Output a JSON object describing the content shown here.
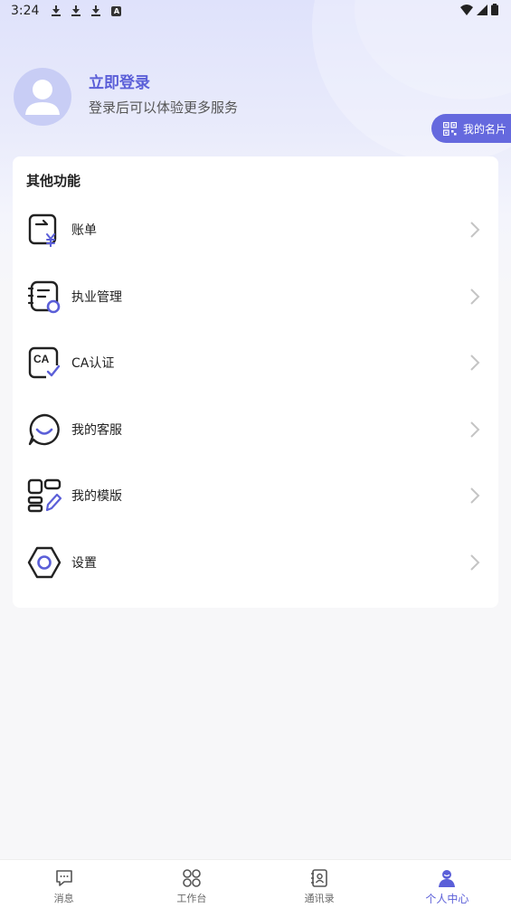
{
  "status_bar": {
    "time": "3:24"
  },
  "profile": {
    "login_title": "立即登录",
    "login_subtitle": "登录后可以体验更多服务",
    "card_button": "我的名片"
  },
  "section": {
    "title": "其他功能",
    "items": [
      {
        "label": "账单",
        "icon": "bill-icon"
      },
      {
        "label": "执业管理",
        "icon": "practice-management-icon"
      },
      {
        "label": "CA认证",
        "icon": "ca-certificate-icon"
      },
      {
        "label": "我的客服",
        "icon": "customer-service-icon"
      },
      {
        "label": "我的模版",
        "icon": "template-icon"
      },
      {
        "label": "设置",
        "icon": "settings-icon"
      }
    ]
  },
  "ca_badge_text": "CA",
  "tabs": [
    {
      "label": "消息",
      "icon": "message-icon",
      "active": false
    },
    {
      "label": "工作台",
      "icon": "workbench-icon",
      "active": false
    },
    {
      "label": "通讯录",
      "icon": "contacts-icon",
      "active": false
    },
    {
      "label": "个人中心",
      "icon": "profile-icon",
      "active": true
    }
  ],
  "colors": {
    "accent": "#5b5fd8",
    "button_bg": "#6569de",
    "avatar_bg": "#c8cdf5"
  }
}
